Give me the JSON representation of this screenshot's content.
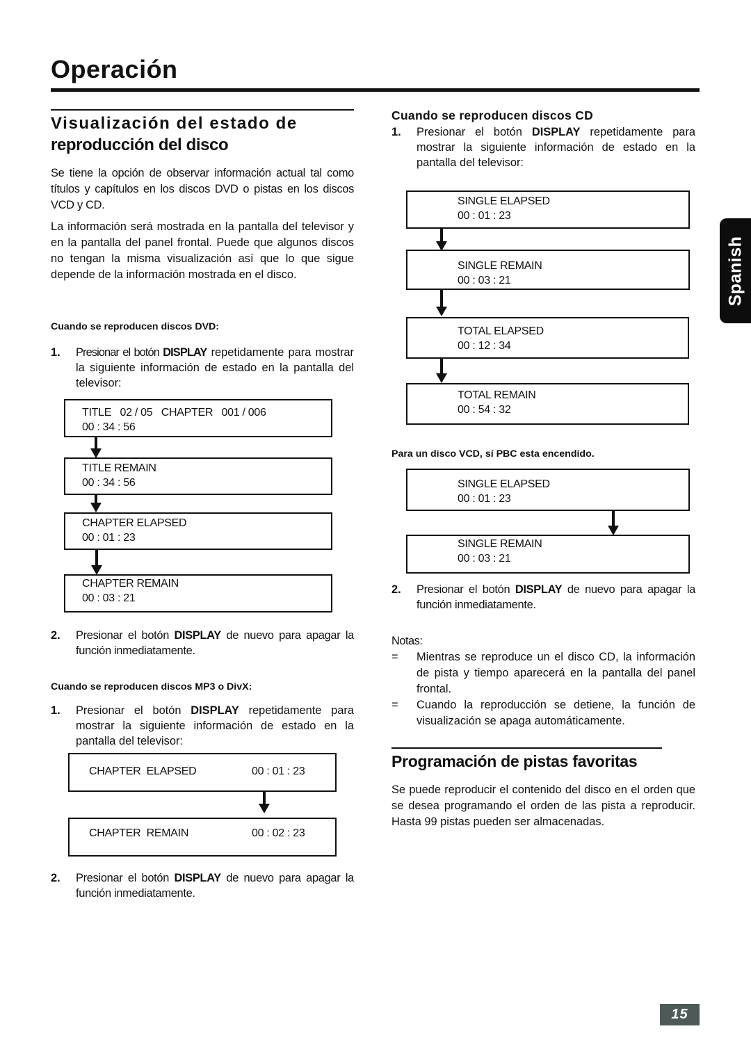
{
  "page": {
    "title": "Operación",
    "language_tab": "Spanish",
    "page_number": "15"
  },
  "left": {
    "heading_line1": "Visualización del estado de",
    "heading_line2": "reproducción del disco",
    "intro_paragraphs": [
      "Se tiene la opción de observar información actual tal como títulos y capítulos en los discos DVD o pistas en los discos VCD y CD.",
      "La información será mostrada en la pantalla del televisor y en la pantalla del panel frontal. Puede que algunos discos no tengan la misma visualización así que lo que sigue depende de la información mostrada en el disco."
    ],
    "dvd": {
      "heading": "Cuando se reproducen discos DVD:",
      "step1": {
        "num": "1.",
        "pre": "Presionar el botón ",
        "bold": "DISPLAY",
        "post": " repetidamente para mostrar la siguiente información de estado en la pantalla del televisor:"
      },
      "boxes": [
        {
          "line1": "TITLE   02 / 05   CHAPTER   001 / 006",
          "line2": "00 : 34 : 56"
        },
        {
          "line1": "TITLE REMAIN",
          "line2": "00 : 34 : 56"
        },
        {
          "line1": "CHAPTER ELAPSED",
          "line2": "00 : 01 : 23"
        },
        {
          "line1": "CHAPTER REMAIN",
          "line2": "00 : 03 : 21"
        }
      ],
      "step2": {
        "num": "2.",
        "pre": "Presionar el botón ",
        "bold": "DISPLAY",
        "post": " de nuevo para apagar la función inmediatamente."
      }
    },
    "mp3": {
      "heading": "Cuando se reproducen discos MP3 o DivX:",
      "step1": {
        "num": "1.",
        "pre": "Presionar el botón ",
        "bold": "DISPLAY",
        "post": " repetidamente para mostrar la siguiente información de estado en la pantalla del televisor:"
      },
      "boxes": [
        {
          "label": "CHAPTER  ELAPSED",
          "time": "00 : 01 : 23"
        },
        {
          "label": "CHAPTER  REMAIN",
          "time": "00 : 02 : 23"
        }
      ],
      "step2": {
        "num": "2.",
        "pre": "Presionar el botón ",
        "bold": "DISPLAY",
        "post": " de nuevo para apagar la función inmediatamente."
      }
    }
  },
  "right": {
    "cd": {
      "heading": "Cuando se reproducen discos CD",
      "step1": {
        "num": "1.",
        "pre": "Presionar el botón ",
        "bold": "DISPLAY",
        "post": " repetidamente para mostrar la siguiente información de estado en la pantalla del televisor:"
      },
      "boxes": [
        {
          "line1": "SINGLE ELAPSED",
          "line2": "00 : 01 : 23"
        },
        {
          "line1": "SINGLE REMAIN",
          "line2": "00 : 03 : 21"
        },
        {
          "line1": "TOTAL ELAPSED",
          "line2": "00 : 12 : 34"
        },
        {
          "line1": "TOTAL REMAIN",
          "line2": "00 : 54 : 32"
        }
      ]
    },
    "vcd": {
      "heading": "Para un disco VCD, sí PBC esta encendido.",
      "boxes": [
        {
          "line1": "SINGLE ELAPSED",
          "line2": "00 : 01 : 23"
        },
        {
          "line1": "SINGLE REMAIN",
          "line2": "00 : 03 : 21"
        }
      ],
      "step2": {
        "num": "2.",
        "pre": "Presionar el botón ",
        "bold": "DISPLAY",
        "post": " de nuevo para apagar la función inmediatamente."
      }
    },
    "notes": {
      "label": "Notas:",
      "items": [
        {
          "bullet": "=",
          "text": "Mientras se reproduce un el disco CD, la información de pista y tiempo aparecerá en la pantalla del panel frontal."
        },
        {
          "bullet": "=",
          "text": "Cuando la reproducción se detiene, la función de visualización se apaga automáticamente."
        }
      ]
    },
    "programming": {
      "heading": "Programación de pistas favoritas",
      "paragraph": "Se puede reproducir el contenido del disco en el orden que se desea programando el orden de las pista a reproducir. Hasta 99 pistas pueden ser almacenadas."
    }
  }
}
